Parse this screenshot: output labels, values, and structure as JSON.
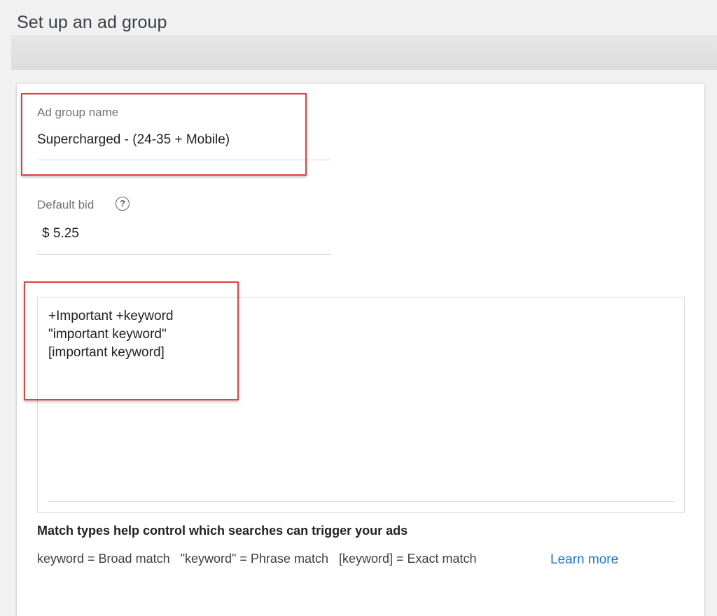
{
  "page": {
    "title": "Set up an ad group"
  },
  "ad_group_name": {
    "label": "Ad group name",
    "value": "Supercharged - (24-35 + Mobile)"
  },
  "default_bid": {
    "label": "Default bid",
    "help_icon": "help-circle-icon",
    "help_glyph": "?",
    "value": "$ 5.25"
  },
  "keywords": {
    "lines": [
      "+Important +keyword",
      "\"important keyword\"",
      "[important keyword]"
    ]
  },
  "match_types": {
    "heading": "Match types help control which searches can trigger your ads",
    "info": "keyword = Broad match   \"keyword\" = Phrase match   [keyword] = Exact match",
    "learn_more": "Learn more"
  },
  "colors": {
    "highlight": "#e0433b",
    "link": "#1a73e8"
  }
}
